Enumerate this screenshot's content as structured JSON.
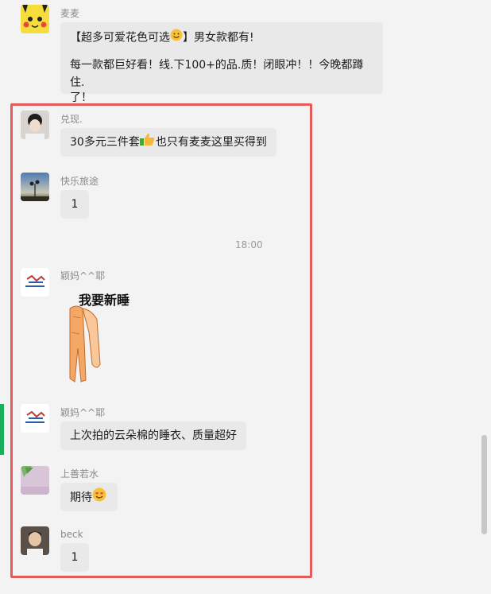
{
  "messages": [
    {
      "sender": "麦麦",
      "line1_pre": "【超多可爱花色可选",
      "line1_post": "】男女款都有!",
      "line2": "每一款都巨好看！线.下100+的品.质！闭眼冲！！今晚都蹲住.",
      "line3": "了！",
      "emoji": "smile-emoji"
    },
    {
      "sender": "兑现.",
      "text_pre": "30多元三件套",
      "text_post": "也只有麦麦这里买得到",
      "emoji": "thumbs-up-emoji"
    },
    {
      "sender": "快乐旅途",
      "text": "1"
    },
    {
      "sender": "颖妈^^耶",
      "sticker_text": "我要新睡"
    },
    {
      "sender": "颖妈^^耶",
      "text": "上次拍的云朵棉的睡衣、质量超好"
    },
    {
      "sender": "上善若水",
      "text": "期待",
      "emoji": "heart-eyes-emoji"
    },
    {
      "sender": "beck",
      "text": "1"
    }
  ],
  "time_divider": "18:00",
  "colors": {
    "highlight": "#e35b5b",
    "bubble": "#e9e9e9",
    "background": "#f3f3f3",
    "accent": "#1aad5b"
  }
}
